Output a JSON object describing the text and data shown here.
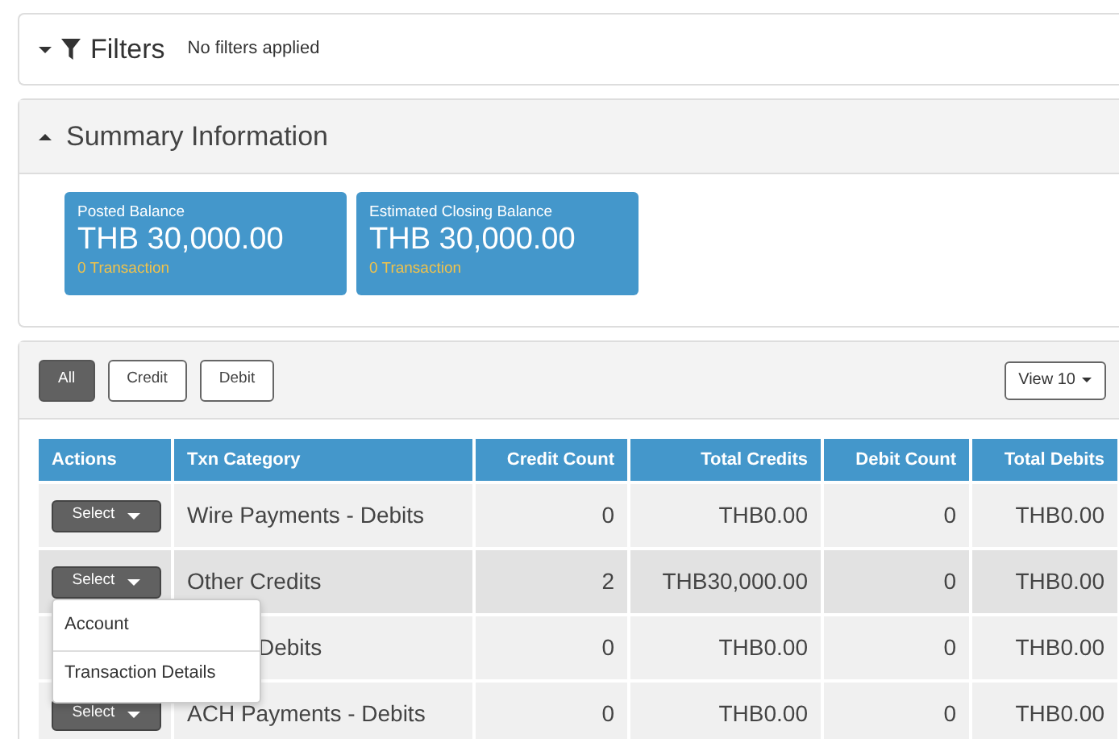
{
  "filters": {
    "title": "Filters",
    "summary": "No filters applied",
    "expanded": false
  },
  "summary": {
    "title": "Summary Information",
    "expanded": true,
    "tiles": [
      {
        "label": "Posted Balance",
        "amount": "THB 30,000.00",
        "count": "0 Transaction"
      },
      {
        "label": "Estimated Closing Balance",
        "amount": "THB 30,000.00",
        "count": "0 Transaction"
      }
    ]
  },
  "type_buttons": [
    {
      "label": "All",
      "selected": true
    },
    {
      "label": "Credit",
      "selected": false
    },
    {
      "label": "Debit",
      "selected": false
    }
  ],
  "view_button": "View 10",
  "table": {
    "columns": [
      "Actions",
      "Txn Category",
      "Credit Count",
      "Total Credits",
      "Debit Count",
      "Total Debits"
    ],
    "rows": [
      {
        "action": "Select",
        "category": "Wire Payments - Debits",
        "credit_count": "0",
        "total_credits": "THB0.00",
        "debit_count": "0",
        "total_debits": "THB0.00",
        "highlighted": false
      },
      {
        "action": "Select",
        "category": "Other Credits",
        "credit_count": "2",
        "total_credits": "THB30,000.00",
        "debit_count": "0",
        "total_debits": "THB0.00",
        "highlighted": true,
        "menu": [
          "Account",
          "Transaction Details"
        ]
      },
      {
        "category": "Debits",
        "partly_covered": true,
        "credit_count": "0",
        "total_credits": "THB0.00",
        "debit_count": "0",
        "total_debits": "THB0.00",
        "highlighted": false
      },
      {
        "action": "Select",
        "category": "ACH Payments - Debits",
        "credit_count": "0",
        "total_credits": "THB0.00",
        "debit_count": "0",
        "total_debits": "THB0.00",
        "highlighted": false
      }
    ]
  }
}
